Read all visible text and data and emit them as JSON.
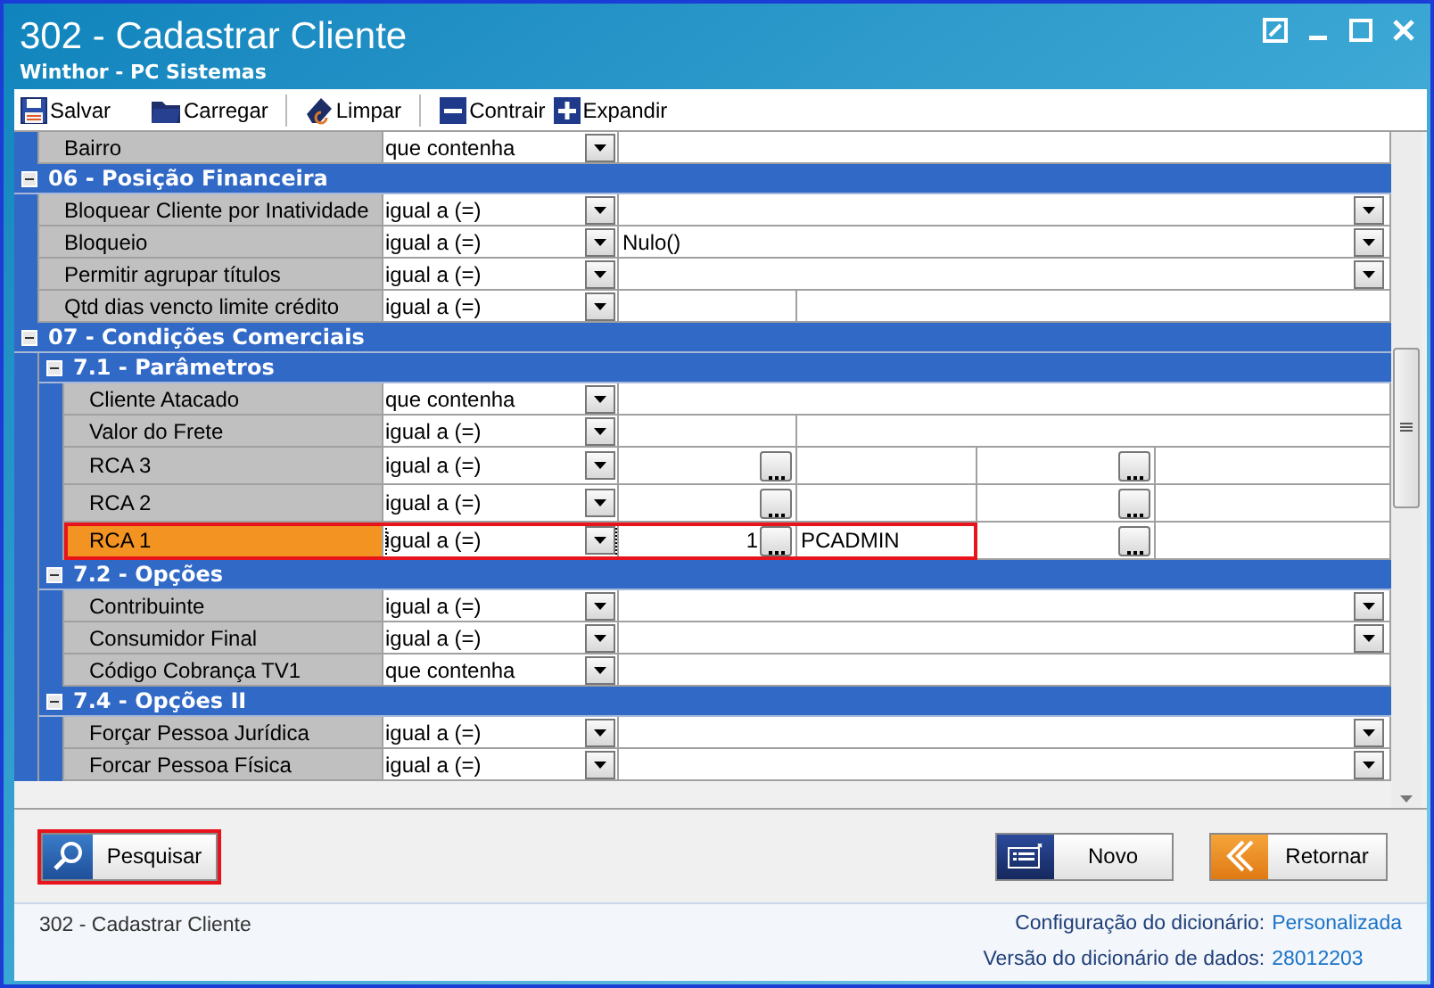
{
  "window": {
    "title": "302 - Cadastrar Cliente",
    "subtitle": "Winthor - PC Sistemas"
  },
  "toolbar": [
    {
      "label": "Salvar",
      "kind": "save"
    },
    {
      "label": "Carregar",
      "kind": "load"
    },
    {
      "label": "Limpar",
      "kind": "clear"
    },
    {
      "label": "Contrair",
      "kind": "collapse"
    },
    {
      "label": "Expandir",
      "kind": "expand"
    }
  ],
  "grid": {
    "items": [
      {
        "kind": "text",
        "label": "Bairro",
        "operator": "que contenha",
        "selected": false
      },
      {
        "kind": "section",
        "title": "06 - Posição Financeira",
        "expanded": true,
        "children": [
          {
            "kind": "dropdown",
            "label": "Bloquear Cliente por Inatividade",
            "operator": "igual a (=)",
            "selected": false
          },
          {
            "kind": "dropdown",
            "label": "Bloqueio",
            "operator": "igual a (=)",
            "value": "Nulo()",
            "selected": false
          },
          {
            "kind": "dropdown",
            "label": "Permitir agrupar títulos",
            "operator": "igual a (=)",
            "selected": false
          },
          {
            "kind": "split",
            "label": "Qtd dias vencto limite crédito",
            "operator": "igual a (=)",
            "selected": false
          }
        ]
      },
      {
        "kind": "section",
        "title": "07 - Condições Comerciais",
        "expanded": true,
        "children": [
          {
            "kind": "section",
            "title": "7.1 - Parâmetros",
            "expanded": true,
            "children": [
              {
                "kind": "text",
                "label": "Cliente Atacado",
                "operator": "que contenha",
                "selected": false
              },
              {
                "kind": "split",
                "label": "Valor do Frete",
                "operator": "igual a (=)",
                "selected": false
              },
              {
                "kind": "lookup",
                "label": "RCA 3",
                "operator": "igual a (=)",
                "selected": false
              },
              {
                "kind": "lookup",
                "label": "RCA 2",
                "operator": "igual a (=)",
                "selected": false
              },
              {
                "kind": "lookup",
                "label": "RCA 1",
                "operator": "igual a (=)",
                "code": "1",
                "description": "PCADMIN",
                "selected": true
              }
            ]
          },
          {
            "kind": "section",
            "title": "7.2 - Opções",
            "expanded": true,
            "children": [
              {
                "kind": "dropdown",
                "label": "Contribuinte",
                "operator": "igual a (=)",
                "selected": false
              },
              {
                "kind": "dropdown",
                "label": "Consumidor Final",
                "operator": "igual a (=)",
                "selected": false
              },
              {
                "kind": "text",
                "label": "Código Cobrança TV1",
                "operator": "que contenha",
                "selected": false
              }
            ]
          },
          {
            "kind": "section",
            "title": "7.4 - Opções II",
            "expanded": true,
            "children": [
              {
                "kind": "dropdown",
                "label": "Forçar Pessoa Jurídica",
                "operator": "igual a (=)",
                "selected": false
              },
              {
                "kind": "dropdown",
                "label": "Forcar Pessoa Física",
                "operator": "igual a (=)",
                "selected": false
              }
            ]
          }
        ]
      }
    ]
  },
  "buttons": [
    {
      "label": "Pesquisar",
      "kind": "search",
      "highlighted": true
    },
    {
      "label": "Novo",
      "kind": "new",
      "highlighted": false
    },
    {
      "label": "Retornar",
      "kind": "back",
      "highlighted": false
    }
  ],
  "status_bar": {
    "title": "302 - Cadastrar Cliente",
    "info": [
      {
        "label": "Configuração do dicionário:",
        "value": "Personalizada"
      },
      {
        "label": "Versão do dicionário de dados:",
        "value": "28012203"
      }
    ]
  }
}
